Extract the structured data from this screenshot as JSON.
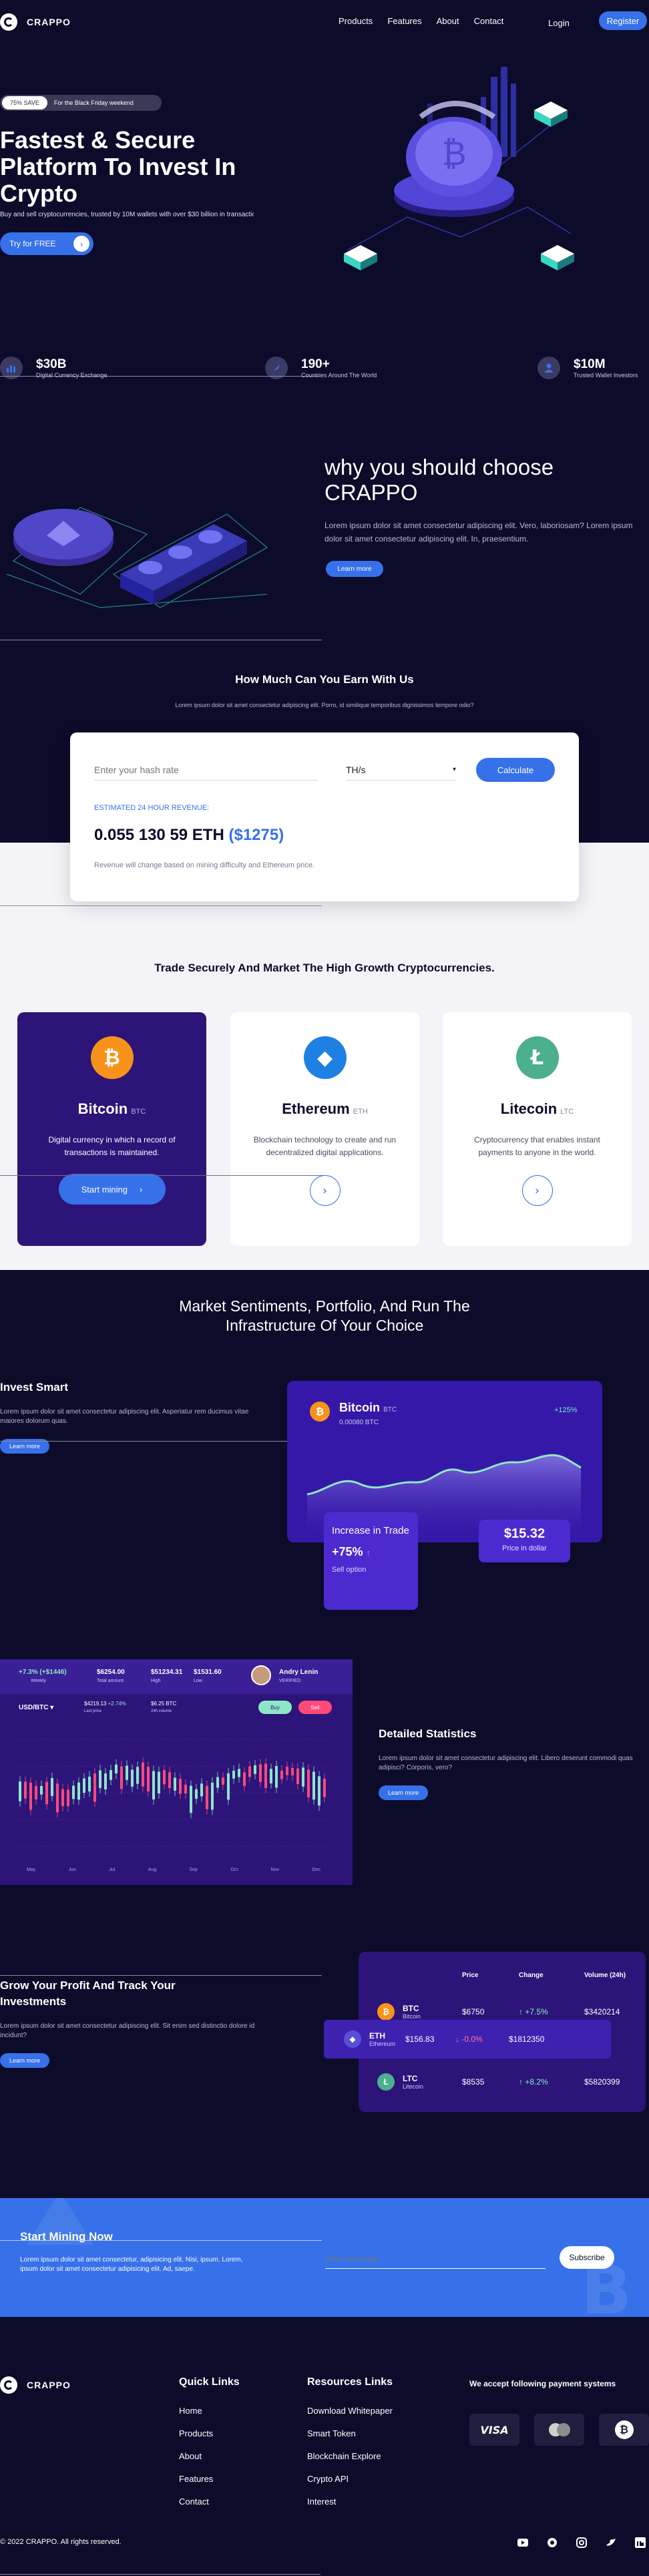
{
  "nav": {
    "brand": "CRAPPO",
    "links": [
      "Products",
      "Features",
      "About",
      "Contact"
    ],
    "login": "Login",
    "register": "Register"
  },
  "hero": {
    "badge_pill": "75% SAVE",
    "badge_text": "For the Black Friday weekend",
    "title_line1": "Fastest & Secure",
    "title_line2": "Platform To Invest In",
    "title_line3": "Crypto",
    "subtitle": "Buy and sell cryptocurrencies, trusted by 10M wallets with over $30 billion in transactions.",
    "cta": "Try for FREE",
    "stats": [
      {
        "value": "$30B",
        "label": "Digital Currency Exchange"
      },
      {
        "value": "190+",
        "label": "Countries Around The World"
      },
      {
        "value": "$10M",
        "label": "Trusted Wallet Investors"
      }
    ]
  },
  "why": {
    "title_line1": "why you should choose",
    "title_line2": "CRAPPO",
    "text": "Lorem ipsum dolor sit amet consectetur adipiscing elit. Vero, laboriosam? Lorem ipsum dolor sit amet consectetur adipiscing elit. In, praesentium.",
    "cta": "Learn more"
  },
  "calculator": {
    "title": "How Much Can You Earn With Us",
    "subtitle": "Lorem ipsum dolor sit amet consectetur adipiscing elit. Porro, id similique temporibus dignissimos tempore odio?",
    "hash_placeholder": "Enter your hash rate",
    "unit": "TH/s",
    "button": "Calculate",
    "estimate_label": "ESTIMATED 24 HOUR REVENUE:",
    "estimate_value": "0.055 130 59 ETH",
    "estimate_usd": "($1275)",
    "note": "Revenue will change based on mining difficulty and Ethereum price."
  },
  "trade": {
    "title": "Trade Securely And Market The High Growth Cryptocurrencies.",
    "cards": [
      {
        "name": "Bitcoin",
        "ticker": "BTC",
        "desc": "Digital currency in which a record of transactions is maintained.",
        "cta": "Start mining",
        "color": "#f7931a",
        "symbol": "₿"
      },
      {
        "name": "Ethereum",
        "ticker": "ETH",
        "desc": "Blockchain technology to create and run decentralized digital applications.",
        "color": "#1e80e3",
        "symbol": "◆"
      },
      {
        "name": "Litecoin",
        "ticker": "LTC",
        "desc": "Cryptocurrency that enables instant payments to anyone in the world.",
        "color": "#4caf8f",
        "symbol": "Ł"
      }
    ]
  },
  "market": {
    "title_line1": "Market Sentiments, Portfolio, And Run The",
    "title_line2": "Infrastructure Of Your Choice"
  },
  "invest": {
    "title": "Invest Smart",
    "text": "Lorem ipsum dolor sit amet consectetur adipiscing elit. Asperiatur rem ducimus vitae maiores dolorum quas.",
    "cta": "Learn more",
    "card_name": "Bitcoin",
    "card_ticker": "BTC",
    "card_amount": "0.00080 BTC",
    "card_change": "+125%",
    "increase_title": "Increase in Trade",
    "increase_value": "+75%",
    "sell_option": "Sell option",
    "price_value": "$15.32",
    "price_label": "Price in dollar"
  },
  "stats": {
    "title": "Detailed Statistics",
    "text": "Lorem ipsum dolor sit amet consectetur adipiscing elit. Libero deserunt commodi quas adipisci? Corporis, vero?",
    "cta": "Learn more",
    "dash": {
      "change": "+7.3% (+$1446)",
      "change_label": "Weekly",
      "total": "$6254.00",
      "total_label": "Total amount",
      "high": "$51234.31",
      "high_label": "High",
      "low": "$1531.60",
      "low_label": "Low",
      "user": "Andry Lenin",
      "user_role": "VERIFIED",
      "pair": "USD/BTC",
      "p1": "$4219.13",
      "p1_change": "+2.74%",
      "p1_label": "Last price",
      "p2": "$6.25 BTC",
      "p2_label": "24h volume",
      "buy": "Buy",
      "sell": "Sell",
      "x_labels": [
        "May",
        "Jun",
        "Jul",
        "Aug",
        "Sep",
        "Oct",
        "Nov",
        "Dec"
      ]
    }
  },
  "track": {
    "title_line1": "Grow Your Profit And Track Your",
    "title_line2": "Investments",
    "text": "Lorem ipsum dolor sit amet consectetur adipiscing elit. Sit enim sed distinctio dolore id incidunt?",
    "cta": "Learn more",
    "headers": [
      "Price",
      "Change",
      "Volume (24h)"
    ],
    "rows": [
      {
        "ticker": "BTC",
        "name": "Bitcoin",
        "price": "$6750",
        "change": "+7.5%",
        "volume": "$3420214",
        "color": "#f7931a",
        "symbol": "₿"
      },
      {
        "ticker": "ETH",
        "name": "Ethereum",
        "price": "$156.83",
        "change": "-0.0%",
        "volume": "$1812350",
        "color": "#5a4fd8",
        "symbol": "◆"
      },
      {
        "ticker": "LTC",
        "name": "Litecoin",
        "price": "$8535",
        "change": "+8.2%",
        "volume": "$5820399",
        "color": "#4caf8f",
        "symbol": "Ł"
      }
    ]
  },
  "cta_band": {
    "title": "Start Mining Now",
    "text": "Lorem ipsum dolor sit amet consectetur, adipisicing elit. Nisi, ipsum. Lorem, ipsum dolor sit amet consectetur adipisicing elit. Ad, saepe.",
    "placeholder": "enter message",
    "button": "Subscribe"
  },
  "footer": {
    "brand": "CRAPPO",
    "quick_title": "Quick Links",
    "quick_links": [
      "Home",
      "Products",
      "About",
      "Features",
      "Contact"
    ],
    "res_title": "Resources Links",
    "res_links": [
      "Download Whitepaper",
      "Smart Token",
      "Blockchain Explore",
      "Crypto API",
      "Interest"
    ],
    "pay_title": "We accept following payment systems",
    "pay": [
      "VISA"
    ],
    "copyright": "© 2022 CRAPPO. All rights reserved."
  },
  "colors": {
    "accent": "#3671e9",
    "bg": "#0c0b2a",
    "purple": "#2c1479"
  }
}
